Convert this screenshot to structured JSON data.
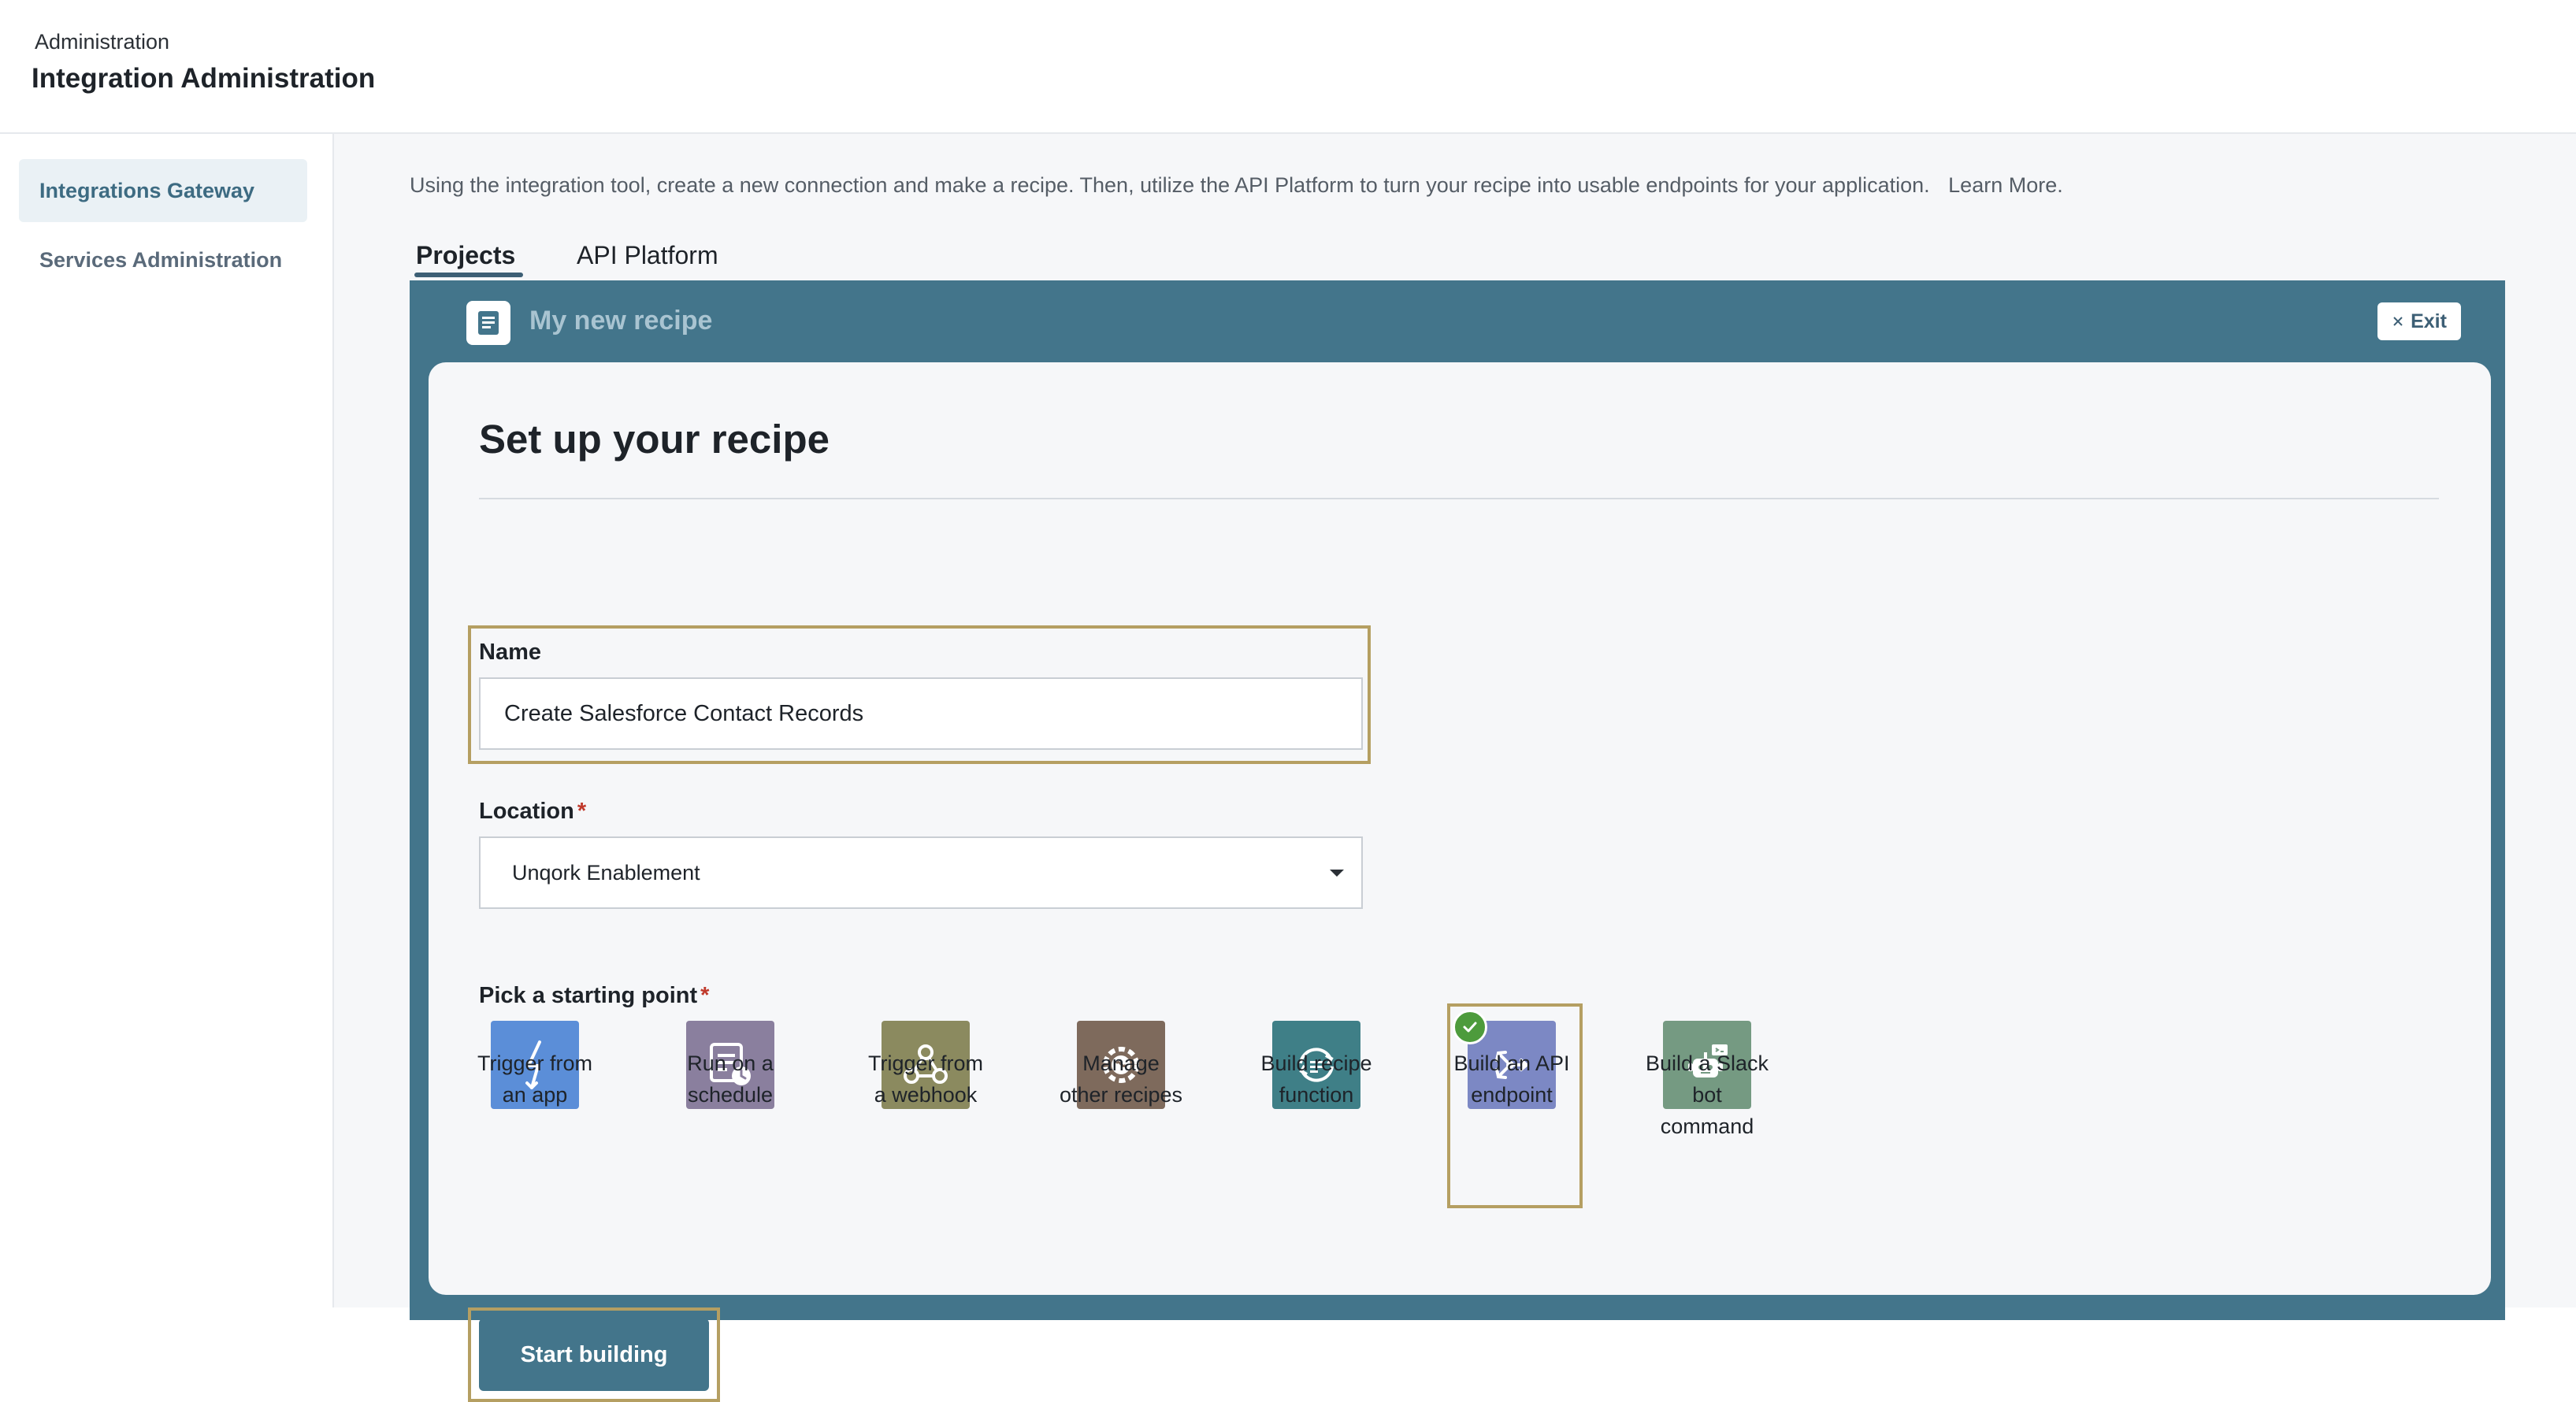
{
  "header": {
    "breadcrumb": "Administration",
    "title": "Integration Administration"
  },
  "sidebar": {
    "items": [
      {
        "label": "Integrations Gateway",
        "active": true
      },
      {
        "label": "Services Administration",
        "active": false
      }
    ]
  },
  "main": {
    "intro_text": "Using the integration tool, create a new connection and make a recipe. Then, utilize the API Platform to turn your recipe into usable endpoints for your application.",
    "learn_more": "Learn More.",
    "tabs": [
      {
        "label": "Projects",
        "active": true
      },
      {
        "label": "API Platform",
        "active": false
      }
    ]
  },
  "recipe": {
    "title": "My new recipe",
    "exit_label": "Exit",
    "card_title": "Set up your recipe",
    "name_label": "Name",
    "name_value": "Create Salesforce Contact Records",
    "location_label": "Location",
    "location_required": "*",
    "location_value": "Unqork Enablement",
    "starting_point_label": "Pick a starting point",
    "starting_point_required": "*",
    "starting_points": [
      {
        "line1": "Trigger from",
        "line2": "an app",
        "line3": "",
        "color": "#5b8ed8",
        "icon": "lightning-icon"
      },
      {
        "line1": "Run on a",
        "line2": "schedule",
        "line3": "",
        "color": "#8a7f9e",
        "icon": "schedule-icon"
      },
      {
        "line1": "Trigger from",
        "line2": "a webhook",
        "line3": "",
        "color": "#8b8a5f",
        "icon": "webhook-icon"
      },
      {
        "line1": "Manage",
        "line2": "other recipes",
        "line3": "",
        "color": "#7e6a5c",
        "icon": "gear-brain-icon"
      },
      {
        "line1": "Build recipe",
        "line2": "function",
        "line3": "",
        "color": "#3f7f87",
        "icon": "function-icon"
      },
      {
        "line1": "Build an API",
        "line2": "endpoint",
        "line3": "",
        "color": "#7c88c4",
        "icon": "api-endpoint-icon",
        "selected": true
      },
      {
        "line1": "Build a Slack",
        "line2": "bot",
        "line3": "command",
        "color": "#759a82",
        "icon": "slack-bot-icon"
      }
    ],
    "start_button": "Start building"
  },
  "colors": {
    "accent": "#43758b",
    "highlight": "#b59f62",
    "selected_check": "#4d9b3c"
  }
}
